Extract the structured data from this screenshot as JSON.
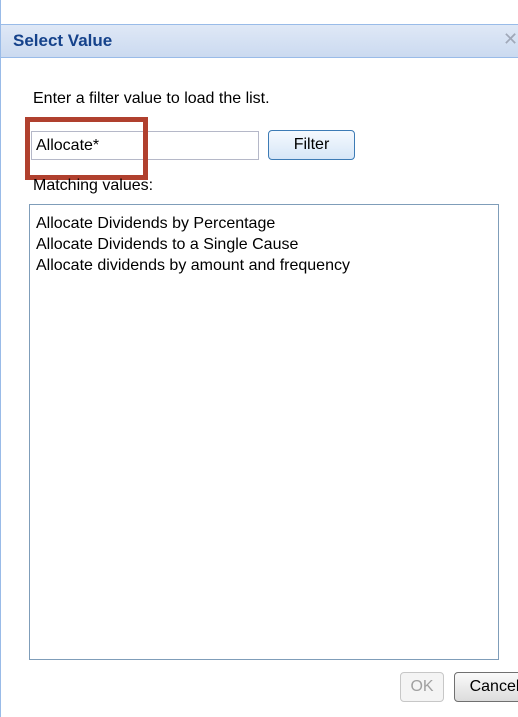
{
  "dialog": {
    "title": "Select Value",
    "close_icon": "close-icon"
  },
  "filter": {
    "instruction": "Enter a filter value to load the list.",
    "input_value": "Allocate*",
    "button_label": "Filter"
  },
  "matching": {
    "label": "Matching values:",
    "items": [
      "Allocate Dividends by Percentage",
      "Allocate Dividends to a Single Cause",
      "Allocate dividends by amount and frequency"
    ]
  },
  "footer": {
    "ok_label": "OK",
    "ok_enabled": false,
    "cancel_label": "Cancel"
  },
  "colors": {
    "title_text": "#15428b",
    "titlebar_bg": "#dfe8f6",
    "highlight": "#b0402e"
  }
}
